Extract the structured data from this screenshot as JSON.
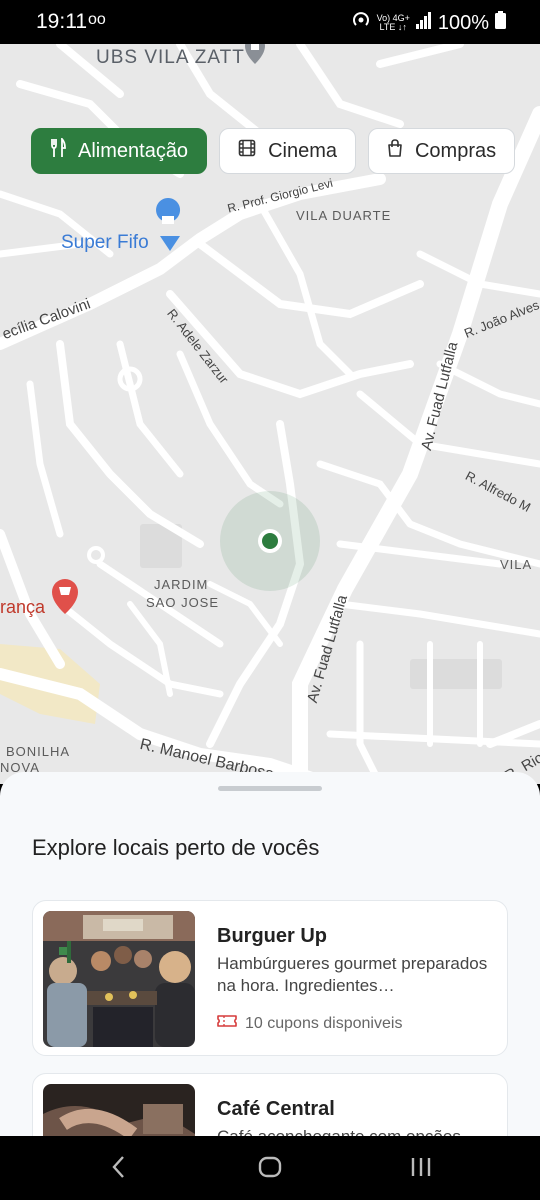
{
  "status_bar": {
    "time": "19:11",
    "voicemail": "oo",
    "network_top": "Vo) 4G+",
    "network_bottom": "LTE ↓↑",
    "battery": "100%"
  },
  "map": {
    "area_labels": [
      "UBS VILA ZATT",
      "VILA DUARTE",
      "JARDIM",
      "SAO JOSE",
      "BONILHA",
      "NOVA",
      "VILA"
    ],
    "pois": [
      "Super Fifo",
      "rança"
    ],
    "streets": [
      "R. Prof. Giorgio Levi",
      "ecília Calovini",
      "R. Adele Zarzur",
      "R. João Alves P",
      "Av. Fuad Lutfalla",
      "R. Alfredo M",
      "Av. Fuad Lutfalla",
      "R. Manoel Barbosa",
      "R. Rio"
    ]
  },
  "categories": [
    {
      "label": "Alimentação",
      "icon": "fork-knife-icon",
      "active": true
    },
    {
      "label": "Cinema",
      "icon": "film-icon",
      "active": false
    },
    {
      "label": "Compras",
      "icon": "shopping-bag-icon",
      "active": false
    }
  ],
  "colors": {
    "accent": "#2d7d3f",
    "coupon_icon": "#d63b3b",
    "map_bg": "#eaeaea"
  },
  "sheet": {
    "title": "Explore locais perto de vocês",
    "places": [
      {
        "name": "Burguer Up",
        "description": "Hambúrgueres gourmet preparados na hora. Ingredientes…",
        "coupons": "10 cupons disponiveis"
      },
      {
        "name": "Café Central",
        "description": "Café aconchegante com opções",
        "coupons": ""
      }
    ]
  }
}
